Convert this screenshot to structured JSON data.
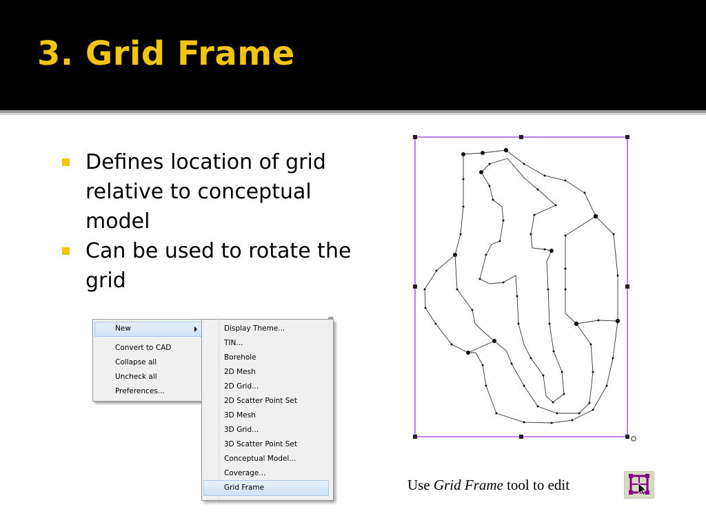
{
  "slide": {
    "title": "3. Grid Frame",
    "bullets": [
      "Defines location of grid relative to conceptual model",
      "Can be used to rotate the grid"
    ],
    "caption": {
      "prefix": "Use ",
      "emphasis": "Grid Frame",
      "suffix": " tool to edit"
    }
  },
  "context_menu": {
    "items": [
      "New",
      "Convert to CAD",
      "Collapse all",
      "Uncheck all",
      "Preferences..."
    ],
    "submenu": [
      "Display Theme...",
      "TIN...",
      "Borehole",
      "2D Mesh",
      "2D Grid...",
      "2D Scatter Point Set",
      "3D Mesh",
      "3D Grid...",
      "3D Scatter Point Set",
      "Conceptual Model...",
      "Coverage...",
      "Grid Frame"
    ],
    "highlighted_item": "New",
    "highlighted_subitem": "Grid Frame"
  },
  "icons": {
    "tool": "grid-frame-tool-icon",
    "cursor": "cursor-arrow-icon"
  },
  "colors": {
    "title": "#f1c40f",
    "bullet": "#f1c40f",
    "frame": "#8a2be2",
    "tool_icon": "#800080"
  }
}
